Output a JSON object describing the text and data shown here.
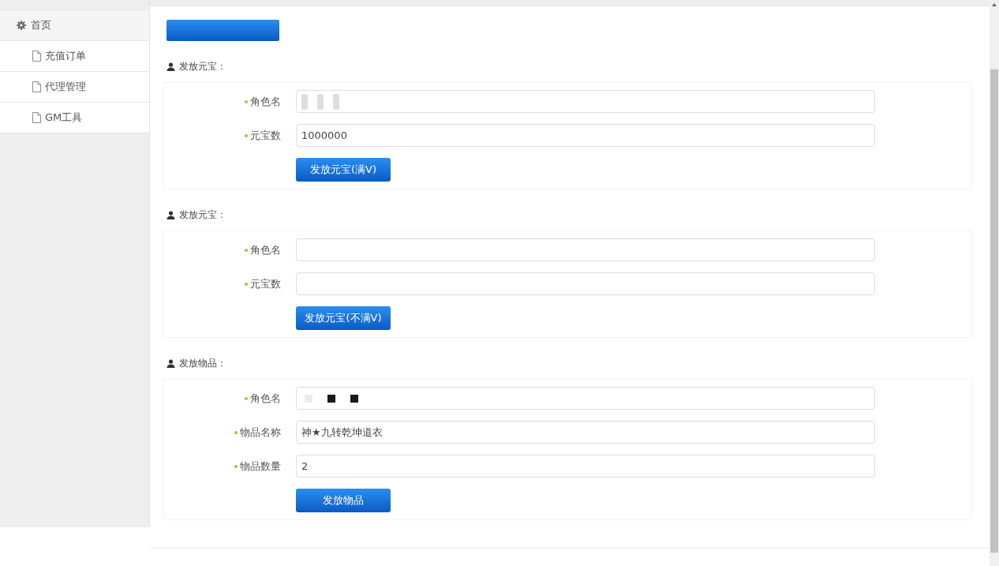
{
  "sidebar": {
    "items": [
      {
        "label": "首页",
        "children": [
          {
            "label": "充值订单"
          },
          {
            "label": "代理管理"
          },
          {
            "label": "GM工具"
          }
        ]
      }
    ]
  },
  "toolbar": {
    "buttons": [
      {
        "kind": "primary"
      }
    ]
  },
  "sections": [
    {
      "title": "发放元宝：",
      "fields": [
        {
          "label": "角色名",
          "required": true,
          "kind": "blurred"
        },
        {
          "label": "元宝数",
          "required": true,
          "kind": "text",
          "value": "1000000"
        }
      ],
      "button": {
        "label": "发放元宝(满V)"
      }
    },
    {
      "title": "发放元宝：",
      "fields": [
        {
          "label": "角色名",
          "required": true,
          "kind": "text"
        },
        {
          "label": "元宝数",
          "required": true,
          "kind": "text"
        }
      ],
      "button": {
        "label": "发放元宝(不满V)"
      }
    },
    {
      "title": "发放物品：",
      "fields": [
        {
          "label": "角色名",
          "required": true,
          "kind": "masked"
        },
        {
          "label": "物品名称",
          "required": true,
          "kind": "text",
          "value": "神★九转乾坤道衣"
        },
        {
          "label": "物品数量",
          "required": true,
          "kind": "text",
          "value": "2"
        }
      ],
      "button": {
        "label": "发放物品"
      }
    }
  ]
}
